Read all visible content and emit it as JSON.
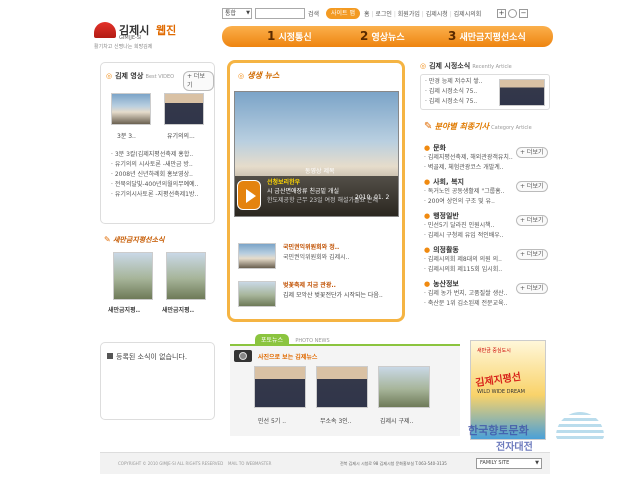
{
  "header": {
    "logo_text": "김제시",
    "logo_sub": "GIM|JE-SI",
    "webzine": "웹진",
    "slogan": "활기차고 신명나는 희망김제",
    "search_select": "통합",
    "search_button": "검색",
    "sitemap_button": "사이트 맵",
    "links": [
      "홈",
      "로그인",
      "회원가입",
      "김제시청",
      "김제시의회"
    ]
  },
  "nav": [
    {
      "num": "1",
      "label": "시정통신"
    },
    {
      "num": "2",
      "label": "영상뉴스"
    },
    {
      "num": "3",
      "label": "새만금지평선소식"
    }
  ],
  "video": {
    "title": "김제 영상",
    "sub": "Best VIDEO",
    "more": "+ 더보기",
    "thumbs": [
      "3분 3..",
      "유기의의..."
    ],
    "items": [
      "3분 3칼(김제지평선축제 홍합..",
      "유기의의 시사토론 -새만금 방..",
      "2008년 신년하례회 홍보영상..",
      "전북의달빛-400년의월의무예예..",
      "유기의시사토론 -지평선축제1방.."
    ]
  },
  "saemangeum": {
    "title": "새만금지평선소식",
    "thumbs": [
      "새만금지평..",
      "새만금지평.."
    ]
  },
  "life_news": {
    "title": "생생 뉴스",
    "video_overlay": [
      "선청보리한우",
      "시 금산면애장류 친금밑 개실",
      "한도제공항 근무 23일 여정 해설가들요 온제"
    ],
    "video_caption": "동영상 제목",
    "video_date": "2010. 01. 2",
    "items": [
      {
        "title": "국민권익위원회와 정..",
        "desc": "국민권익위원회와 김제시.."
      },
      {
        "title": "벚꽃축제 지금 관광..",
        "desc": "김제 모악산 벚꽃전단가 시작되는 다음.."
      }
    ]
  },
  "city_news": {
    "title": "김제 시정소식",
    "sub": "Recently Article",
    "items": [
      "만경 능제 저수지 쌓..",
      "김제 시정소식 75..",
      "김제 시정소식 75.."
    ]
  },
  "category": {
    "title": "분야별 최종기사",
    "sub": "Category Article",
    "more": "+ 더보기",
    "sections": [
      {
        "title": "문화",
        "lines": [
          "김제지평선축제, 해외관광객유치..",
          "벽골제, 체험관광코스 개발계.."
        ]
      },
      {
        "title": "사회, 복지",
        "lines": [
          "독거노인 공동생활제 \"그룹홈..",
          "200여 상인의 구조 및 유.."
        ]
      },
      {
        "title": "행정일반",
        "lines": [
          "민선5기 달라진 인원시책..",
          "김제시 구청제 유입 적인배우.."
        ]
      },
      {
        "title": "의정활동",
        "lines": [
          "김제시의회 제8대의 의원 의..",
          "김제시의회 제115회 임시회.."
        ]
      },
      {
        "title": "농산정보",
        "lines": [
          "김제 농가 번지, 고품질쌀 생산..",
          "축산문 1위 김소된제 전문교육.."
        ]
      }
    ]
  },
  "notice": {
    "text": "등록된 소식이 없습니다."
  },
  "photo_news": {
    "tab1": "포토뉴스",
    "tab2": "PHOTO NEWS",
    "label": "사진으로 보는 김제뉴스",
    "captions": [
      "민선 5기 ..",
      "무소속 3인..",
      "김제시 구제.."
    ]
  },
  "banner": {
    "top": "새만금 중심도시",
    "title": "김제지평선",
    "sub": "WILD WIDE DREAM"
  },
  "footer": {
    "copyright": "COPYRIGHT © 2010 GIMJE-SI ALL RIGHTS RESERVED",
    "mail": "MAIL TO WEBMASTER",
    "address": "전북 김제시 시청로 98 김제시청 문화홍보실 T.063-540-3135",
    "family_site": "FAMILY SITE"
  },
  "watermark": {
    "line1": "한국향토문화",
    "line2": "전자대전"
  },
  "colors": {
    "accent": "#f08a10",
    "nav": "#f2941e",
    "brand_red": "#d8241b"
  }
}
